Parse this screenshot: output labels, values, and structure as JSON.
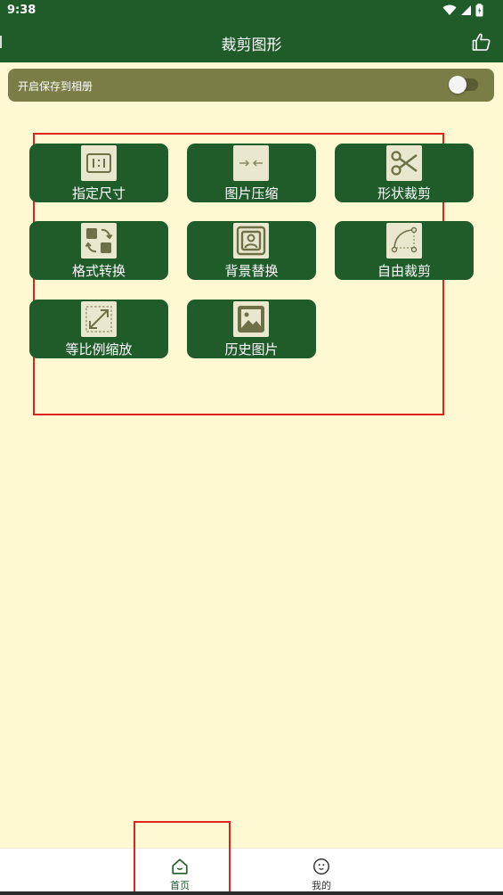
{
  "status_bar": {
    "time": "9:38"
  },
  "app_bar": {
    "title": "裁剪图形",
    "action_icon": "thumbs-up-icon"
  },
  "save_toggle": {
    "label": "开启保存到相册",
    "enabled": false
  },
  "features": [
    {
      "label": "指定尺寸",
      "icon": "aspect-ratio-icon"
    },
    {
      "label": "图片压缩",
      "icon": "compress-arrows-icon"
    },
    {
      "label": "形状裁剪",
      "icon": "scissors-icon"
    },
    {
      "label": "格式转换",
      "icon": "format-convert-icon"
    },
    {
      "label": "背景替换",
      "icon": "portrait-icon"
    },
    {
      "label": "自由裁剪",
      "icon": "curve-path-icon"
    },
    {
      "label": "等比例缩放",
      "icon": "resize-diagonal-icon"
    },
    {
      "label": "历史图片",
      "icon": "image-icon"
    }
  ],
  "bottom_nav": [
    {
      "label": "首页",
      "icon": "home-icon",
      "active": true,
      "color": "#1f5c2a"
    },
    {
      "label": "我的",
      "icon": "smiley-icon",
      "active": false,
      "color": "#333333"
    }
  ],
  "colors": {
    "primary": "#1f5c2a",
    "background": "#fef9d2",
    "toggle_bar": "#7b7d46",
    "icon_bg": "#e9e8cf",
    "highlight": "#e0241c"
  }
}
